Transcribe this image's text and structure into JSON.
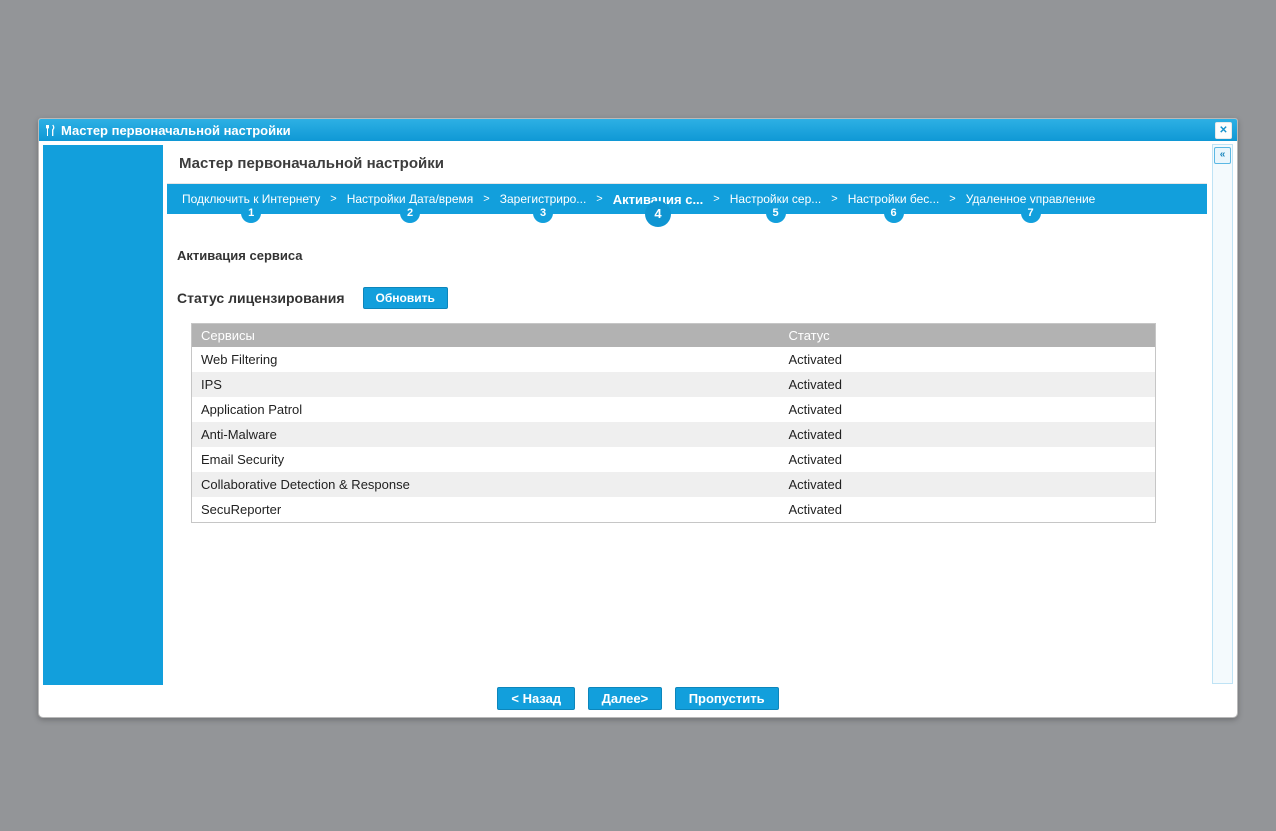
{
  "window": {
    "title": "Мастер первоначальной настройки",
    "close_label": "✕"
  },
  "page": {
    "title": "Мастер первоначальной настройки"
  },
  "steps": {
    "separator": ">",
    "items": [
      {
        "label": "Подключить к Интернету",
        "number": "1"
      },
      {
        "label": "Настройки Дата/время",
        "number": "2"
      },
      {
        "label": "Зарегистриро...",
        "number": "3"
      },
      {
        "label": "Активация с...",
        "number": "4"
      },
      {
        "label": "Настройки сер...",
        "number": "5"
      },
      {
        "label": "Настройки бес...",
        "number": "6"
      },
      {
        "label": "Удаленное управление",
        "number": "7"
      }
    ],
    "active_step": "4"
  },
  "section": {
    "heading": "Активация сервиса",
    "license_heading": "Статус лицензирования",
    "refresh_button": "Обновить"
  },
  "table": {
    "columns": [
      "Сервисы",
      "Статус"
    ],
    "rows": [
      [
        "Web Filtering",
        "Activated"
      ],
      [
        "IPS",
        "Activated"
      ],
      [
        "Application Patrol",
        "Activated"
      ],
      [
        "Anti-Malware",
        "Activated"
      ],
      [
        "Email Security",
        "Activated"
      ],
      [
        "Collaborative Detection & Response",
        "Activated"
      ],
      [
        "SecuReporter",
        "Activated"
      ]
    ]
  },
  "footer": {
    "back": "< Назад",
    "next": "Далее>",
    "skip": "Пропустить"
  },
  "collapse": {
    "label": "«"
  },
  "colors": {
    "accent": "#129fdc",
    "table_header": "#b2b2b2",
    "row_alt": "#efefef",
    "desktop": "#939598"
  }
}
